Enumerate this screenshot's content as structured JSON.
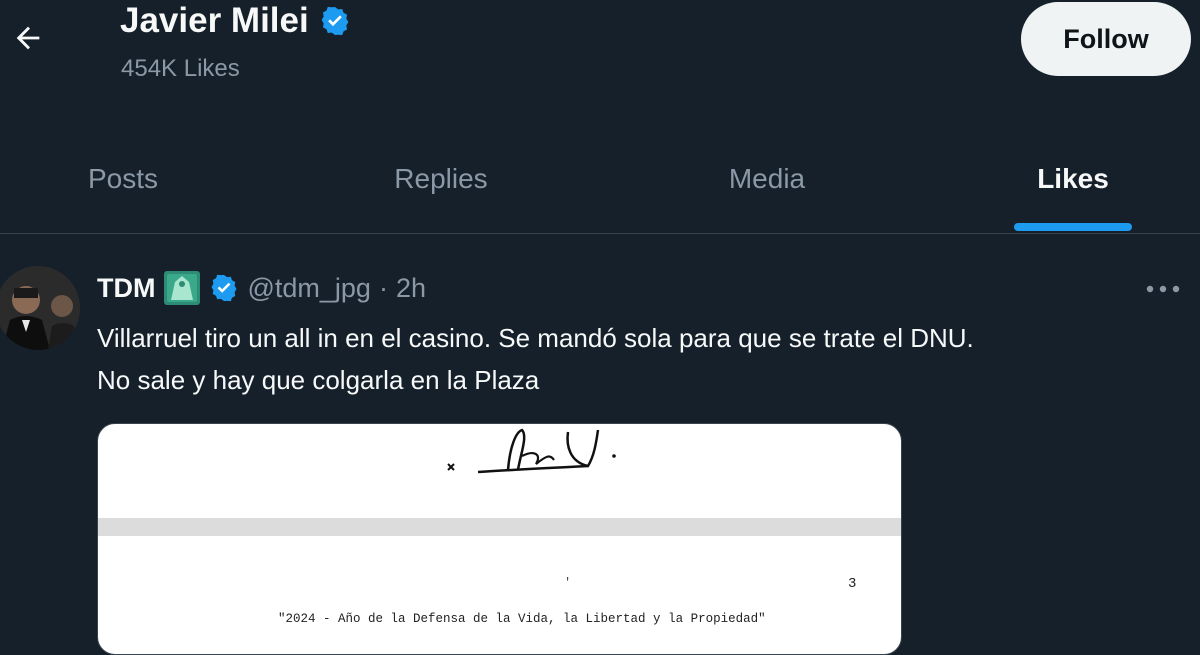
{
  "header": {
    "name": "Javier Milei",
    "likes_count": "454K Likes",
    "follow_label": "Follow"
  },
  "tabs": [
    {
      "label": "Posts",
      "active": false
    },
    {
      "label": "Replies",
      "active": false
    },
    {
      "label": "Media",
      "active": false
    },
    {
      "label": "Likes",
      "active": true
    }
  ],
  "tweet": {
    "author": "TDM",
    "handle": "@tdm_jpg",
    "separator": "·",
    "time": "2h",
    "text_lines": [
      "Villarruel tiro un all in en el casino. Se mandó sola para que se trate el DNU.",
      "No sale y hay que colgarla en la Plaza"
    ],
    "media": {
      "page_number": "3",
      "caption": "\"2024 - Año de la Defensa de la Vida, la Libertad y la Propiedad\""
    }
  },
  "colors": {
    "background": "#15202b",
    "accent": "#1d9bf0",
    "text_primary": "#f7f9f9",
    "text_secondary": "#8b98a5"
  },
  "icons": {
    "back": "arrow-left-icon",
    "verified": "verified-badge-icon",
    "affiliate": "affiliate-badge-icon",
    "more": "more-horizontal-icon"
  }
}
